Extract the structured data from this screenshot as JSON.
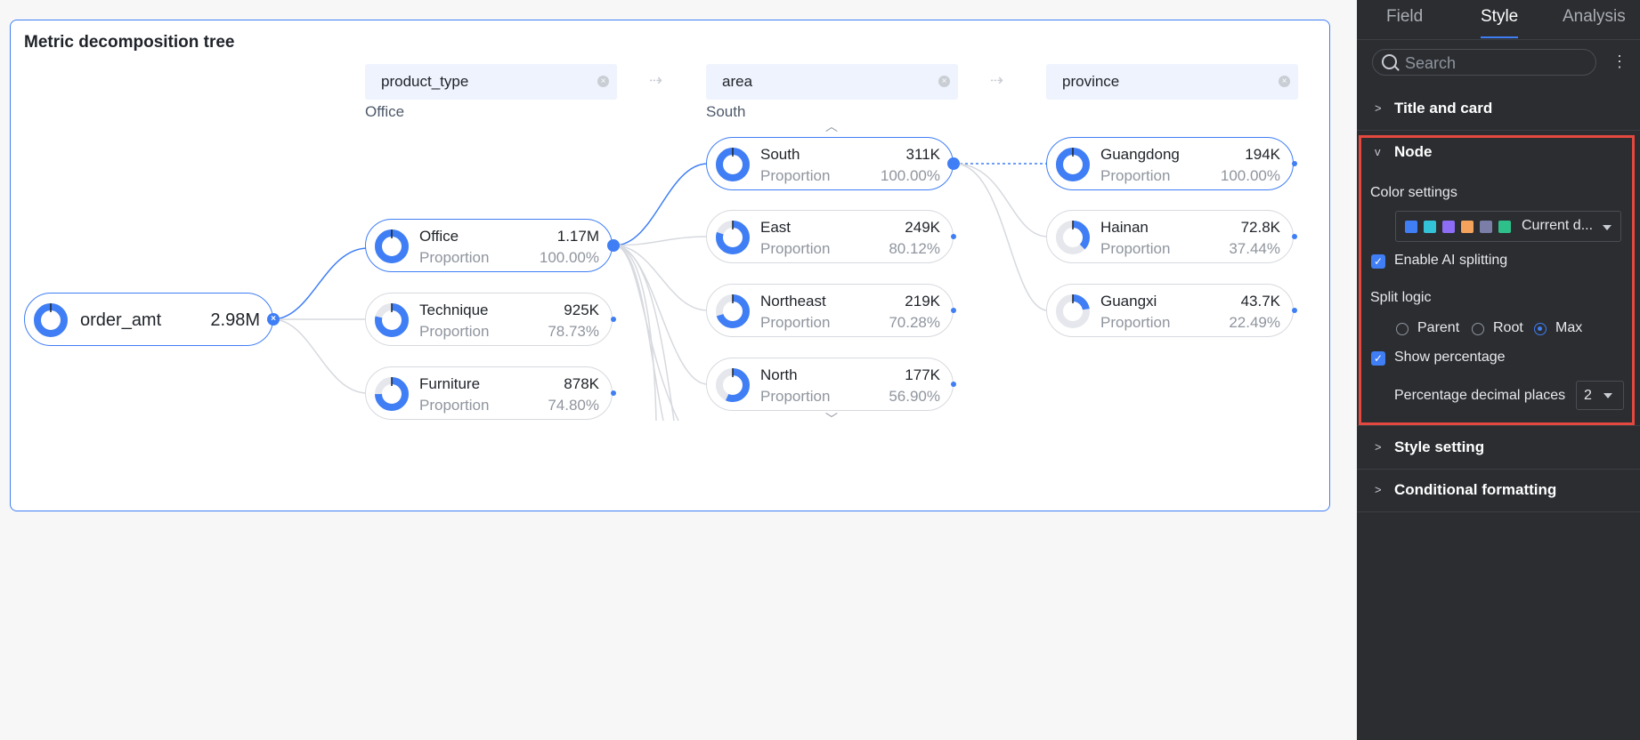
{
  "card": {
    "title": "Metric decomposition tree"
  },
  "dimensions": [
    {
      "label": "product_type",
      "selected": "Office"
    },
    {
      "label": "area",
      "selected": "South"
    },
    {
      "label": "province",
      "selected": ""
    }
  ],
  "root": {
    "name": "order_amt",
    "value": "2.98M",
    "fraction": 1.0
  },
  "level1": [
    {
      "name": "Office",
      "value": "1.17M",
      "sub": "Proportion",
      "pct": "100.00%",
      "fraction": 1.0
    },
    {
      "name": "Technique",
      "value": "925K",
      "sub": "Proportion",
      "pct": "78.73%",
      "fraction": 0.7873
    },
    {
      "name": "Furniture",
      "value": "878K",
      "sub": "Proportion",
      "pct": "74.80%",
      "fraction": 0.748
    }
  ],
  "level2": [
    {
      "name": "South",
      "value": "311K",
      "sub": "Proportion",
      "pct": "100.00%",
      "fraction": 1.0
    },
    {
      "name": "East",
      "value": "249K",
      "sub": "Proportion",
      "pct": "80.12%",
      "fraction": 0.8012
    },
    {
      "name": "Northeast",
      "value": "219K",
      "sub": "Proportion",
      "pct": "70.28%",
      "fraction": 0.7028
    },
    {
      "name": "North",
      "value": "177K",
      "sub": "Proportion",
      "pct": "56.90%",
      "fraction": 0.569
    }
  ],
  "level3": [
    {
      "name": "Guangdong",
      "value": "194K",
      "sub": "Proportion",
      "pct": "100.00%",
      "fraction": 1.0
    },
    {
      "name": "Hainan",
      "value": "72.8K",
      "sub": "Proportion",
      "pct": "37.44%",
      "fraction": 0.3744
    },
    {
      "name": "Guangxi",
      "value": "43.7K",
      "sub": "Proportion",
      "pct": "22.49%",
      "fraction": 0.2249
    }
  ],
  "panel": {
    "tabs": [
      "Field",
      "Style",
      "Analysis"
    ],
    "active_tab": "Style",
    "search_placeholder": "Search",
    "sections": {
      "title_and_card": "Title and card",
      "node": "Node",
      "style_setting": "Style setting",
      "conditional_formatting": "Conditional formatting"
    },
    "node": {
      "color_settings_label": "Color settings",
      "palette": [
        "#3f7ef5",
        "#33c3d9",
        "#8d6cf6",
        "#f5a35c",
        "#7b7ea6",
        "#2ec08b"
      ],
      "palette_label": "Current d...",
      "enable_ai_label": "Enable AI splitting",
      "enable_ai_checked": true,
      "split_logic_label": "Split logic",
      "split_options": [
        "Parent",
        "Root",
        "Max"
      ],
      "split_selected": "Max",
      "show_percentage_label": "Show percentage",
      "show_percentage_checked": true,
      "decimal_label": "Percentage decimal places",
      "decimal_value": "2"
    }
  },
  "colors": {
    "accent": "#3f7ef5",
    "highlight": "#e5483f",
    "panel_bg": "#2b2d31"
  }
}
